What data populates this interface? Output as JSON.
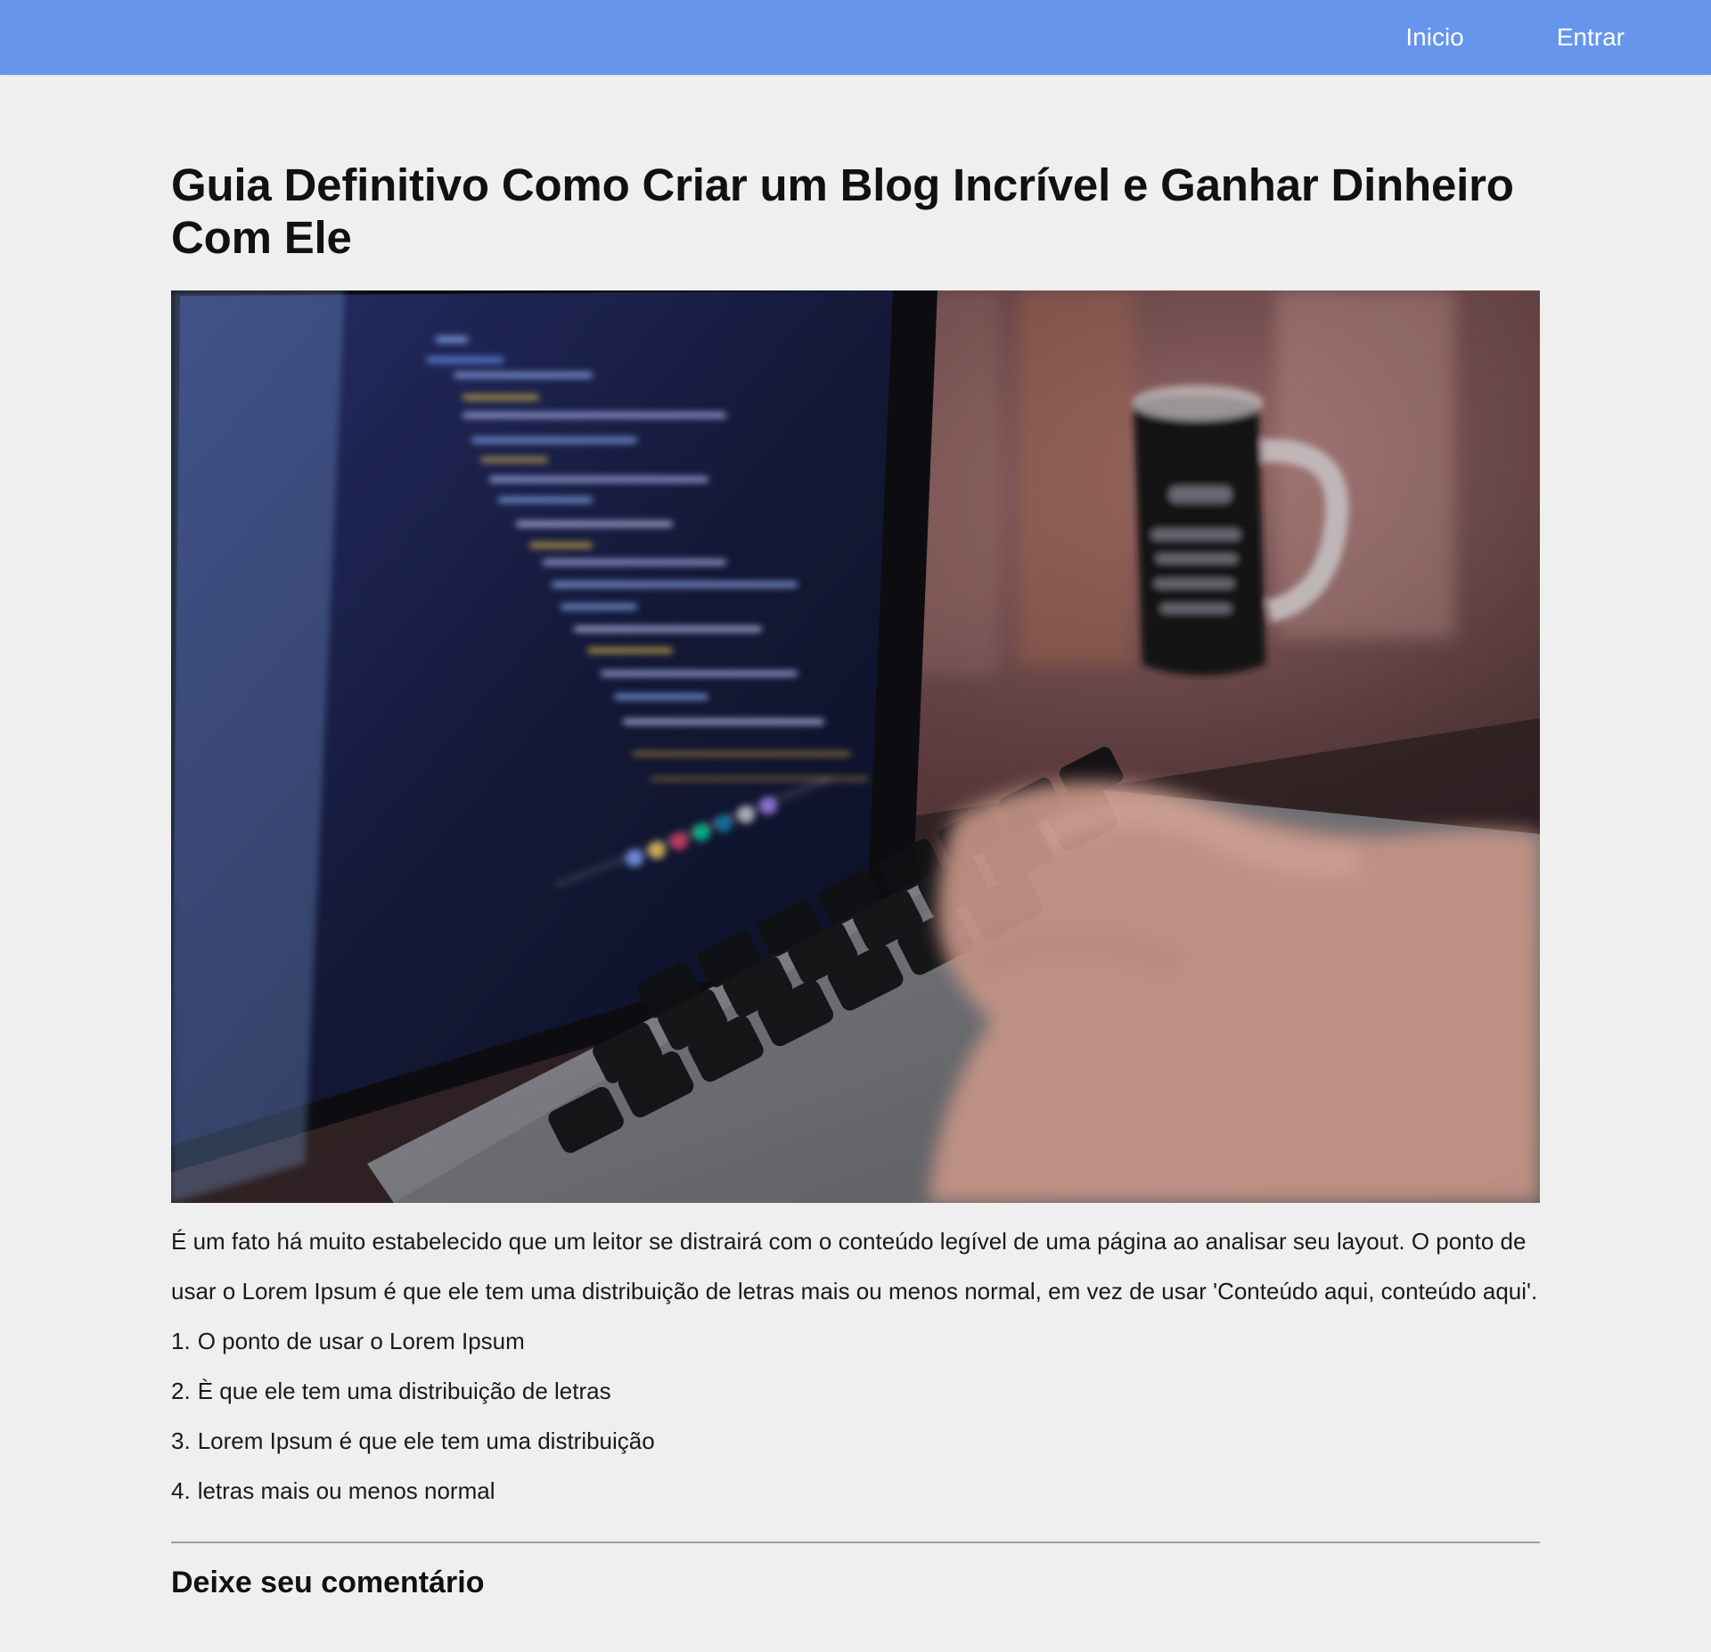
{
  "nav": {
    "items": [
      {
        "label": "Inicio"
      },
      {
        "label": "Entrar"
      }
    ]
  },
  "article": {
    "title": "Guia Definitivo Como Criar um Blog Incrível e Ganhar Dinheiro Com Ele",
    "paragraph": "É um fato há muito estabelecido que um leitor se distrairá com o conteúdo legível de uma página ao analisar seu layout. O ponto de usar o Lorem Ipsum é que ele tem uma distribuição de letras mais ou menos normal, em vez de usar 'Conteúdo aqui, conteúdo aqui'.",
    "list": [
      {
        "num": "1.",
        "text": "O ponto de usar o Lorem Ipsum"
      },
      {
        "num": "2.",
        "text": "È que ele tem uma distribuição de letras"
      },
      {
        "num": "3.",
        "text": "Lorem Ipsum é que ele tem uma distribuição"
      },
      {
        "num": "4.",
        "text": "letras mais ou menos normal"
      }
    ]
  },
  "comments": {
    "heading": "Deixe seu comentário"
  },
  "colors": {
    "header_bg": "#6795ec",
    "page_bg": "#efefef"
  }
}
